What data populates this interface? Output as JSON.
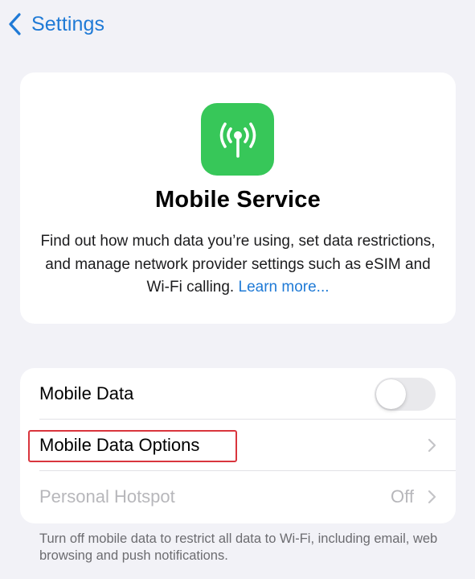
{
  "nav": {
    "back_label": "Settings",
    "back_icon": "chevron-left-icon"
  },
  "info": {
    "icon": "antenna-icon",
    "icon_color": "#37c759",
    "title": "Mobile Service",
    "description": "Find out how much data you’re using, set data restrictions, and manage network provider settings such as eSIM and Wi-Fi calling.",
    "link": "Learn more..."
  },
  "list": {
    "rows": [
      {
        "label": "Mobile Data",
        "control": "toggle",
        "toggle_on": false
      },
      {
        "label": "Mobile Data Options",
        "control": "chevron",
        "highlighted": true
      },
      {
        "label": "Personal Hotspot",
        "value": "Off",
        "control": "chevron",
        "disabled": true
      }
    ]
  },
  "footnote": "Turn off mobile data to restrict all data to Wi-Fi, including email, web browsing and push notifications.",
  "colors": {
    "accent": "#1f7ad6",
    "background": "#f2f2f7",
    "highlight_border": "#d9353d"
  }
}
